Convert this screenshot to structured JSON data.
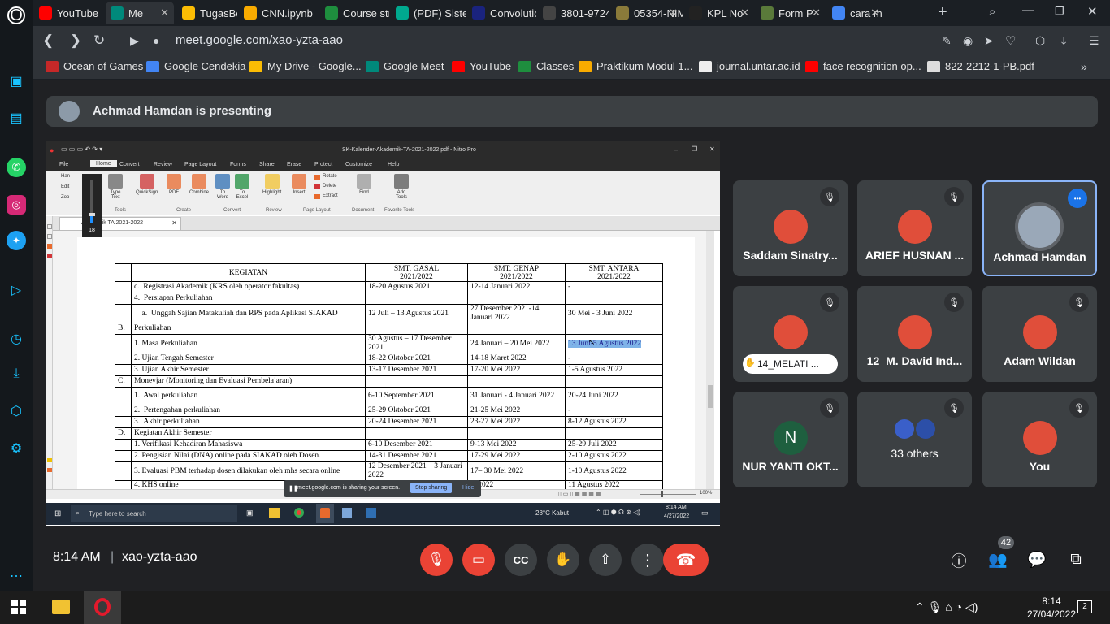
{
  "browser": {
    "tabs": [
      {
        "label": "YouTube",
        "icon": "youtube-icon",
        "color": "#ff0000"
      },
      {
        "label": "Me",
        "icon": "meet-icon",
        "color": "#00897b",
        "active": true
      },
      {
        "label": "TugasBesa",
        "icon": "drive-icon",
        "color": "#fbbc04"
      },
      {
        "label": "CNN.ipynb",
        "icon": "colab-icon",
        "color": "#f9ab00"
      },
      {
        "label": "Course str",
        "icon": "classroom-icon",
        "color": "#1e8e3e"
      },
      {
        "label": "(PDF) Siste",
        "icon": "researchgate-icon",
        "color": "#00a98f"
      },
      {
        "label": "Convolutio",
        "icon": "globe-icon",
        "color": "#1a237e"
      },
      {
        "label": "3801-9724",
        "icon": "globe-icon",
        "color": "#444"
      },
      {
        "label": "05354-NIM",
        "icon": "globe-icon",
        "color": "#8a7a3a"
      },
      {
        "label": "KPL No",
        "icon": "github-icon",
        "color": "#222"
      },
      {
        "label": "Form P",
        "icon": "globe-icon",
        "color": "#5a7a3a"
      },
      {
        "label": "cara m",
        "icon": "google-icon",
        "color": "#4285f4"
      }
    ],
    "url": "meet.google.com/xao-yzta-aao",
    "bookmarks": [
      {
        "label": "Ocean of Games",
        "icon": "gamepad-icon",
        "color": "#c62828"
      },
      {
        "label": "Google Cendekia",
        "icon": "scholar-icon",
        "color": "#4285f4"
      },
      {
        "label": "My Drive - Google...",
        "icon": "drive-icon",
        "color": "#fbbc04"
      },
      {
        "label": "Google Meet",
        "icon": "meet-icon",
        "color": "#00897b"
      },
      {
        "label": "YouTube",
        "icon": "youtube-icon",
        "color": "#ff0000"
      },
      {
        "label": "Classes",
        "icon": "classroom-icon",
        "color": "#1e8e3e"
      },
      {
        "label": "Praktikum Modul 1...",
        "icon": "colab-icon",
        "color": "#f9ab00"
      },
      {
        "label": "journal.untar.ac.id",
        "icon": "pkp-icon",
        "color": "#eeeeee"
      },
      {
        "label": "face recognition op...",
        "icon": "youtube-icon",
        "color": "#ff0000"
      },
      {
        "label": "822-2212-1-PB.pdf",
        "icon": "file-icon",
        "color": "#dddddd"
      }
    ]
  },
  "meet": {
    "presenter_banner": "Achmad Hamdan is presenting",
    "clock": "8:14 AM",
    "divider": "|",
    "meeting_code": "xao-yzta-aao",
    "participant_count": "42",
    "participants": [
      {
        "name": "Saddam Sinatry...",
        "muted": true
      },
      {
        "name": "ARIEF HUSNAN ...",
        "muted": true
      },
      {
        "name": "Achmad Hamdan",
        "muted": false,
        "speaking": true
      },
      {
        "name": "14_MELATI ...",
        "muted": true,
        "hand_raised": true
      },
      {
        "name": "12_M. David Ind...",
        "muted": true
      },
      {
        "name": "Adam Wildan",
        "muted": true
      },
      {
        "name": "NUR YANTI OKT...",
        "muted": true,
        "initial": "N",
        "avatar_color": "#1e5f3f"
      },
      {
        "name": "33 others",
        "muted": true
      },
      {
        "name": "You",
        "muted": true
      }
    ]
  },
  "nitro": {
    "title": "SK-Kalender-Akademik-TA-2021-2022.pdf - Nitro Pro",
    "menu": [
      "File",
      "Home",
      "Convert",
      "Review",
      "Page Layout",
      "Forms",
      "Share",
      "Erase",
      "Protect",
      "Customize",
      "Help"
    ],
    "ribbon": [
      {
        "label": "Type\nText"
      },
      {
        "label": "QuickSign"
      },
      {
        "label": "PDF"
      },
      {
        "label": "Combine"
      },
      {
        "label": "To\nWord"
      },
      {
        "label": "To\nExcel"
      },
      {
        "label": "Highlight"
      },
      {
        "label": "Insert"
      },
      {
        "label": "Rotate"
      },
      {
        "label": "Delete"
      },
      {
        "label": "Extract"
      },
      {
        "label": "Find"
      },
      {
        "label": "Add\nTools"
      }
    ],
    "groups": [
      "Tools",
      "Create",
      "Convert",
      "Review",
      "Page Layout",
      "Document",
      "Favorite Tools"
    ],
    "left_tools": [
      "Han",
      "Edit",
      "Zoo"
    ],
    "doc_tab": "Akademik TA 2021-2022",
    "volume": "18",
    "zoom": "100%",
    "table": {
      "headers": [
        "KEGIATAN",
        "SMT. GASAL\n2021/2022",
        "SMT. GENAP\n2021/2022",
        "SMT. ANTARA\n2021/2022"
      ],
      "rows": [
        {
          "no": "",
          "text": "c.  Registrasi Akademik (KRS oleh operator fakultas)",
          "gasal": "18-20 Agustus 2021",
          "genap": "12-14 Januari 2022",
          "antara": "-"
        },
        {
          "no": "",
          "text": "4.  Persiapan Perkuliahan",
          "gasal": "",
          "genap": "",
          "antara": ""
        },
        {
          "no": "",
          "text": "    a.  Unggah Sajian Matakuliah dan RPS pada Aplikasi SIAKAD",
          "gasal": "12 Juli – 13 Agustus 2021",
          "genap": "27 Desember 2021-14 Januari 2022",
          "antara": "30 Mei - 3 Juni 2022"
        },
        {
          "no": "B.",
          "text": "Perkuliahan",
          "gasal": "",
          "genap": "",
          "antara": ""
        },
        {
          "no": "",
          "text": "1. Masa Perkuliahan",
          "gasal": "30 Agustus – 17 Desember 2021",
          "genap": "24 Januari – 20 Mei 2022",
          "antara": "13 Juni-5 Agustus 2022",
          "highlight": true
        },
        {
          "no": "",
          "text": "2. Ujian Tengah Semester",
          "gasal": "18-22 Oktober 2021",
          "genap": "14-18 Maret 2022",
          "antara": "-"
        },
        {
          "no": "",
          "text": "3. Ujian Akhir Semester",
          "gasal": "13-17 Desember 2021",
          "genap": "17-20 Mei 2022",
          "antara": "1-5 Agustus 2022"
        },
        {
          "no": "C.",
          "text": "Monevjar (Monitoring dan Evaluasi Pembelajaran)",
          "gasal": "",
          "genap": "",
          "antara": ""
        },
        {
          "no": "",
          "text": "1.  Awal perkuliahan",
          "gasal": "6-10 September 2021",
          "genap": "31 Januari - 4 Januari 2022",
          "antara": "20-24 Juni 2022"
        },
        {
          "no": "",
          "text": "2.  Pertengahan perkuliahan",
          "gasal": "25-29 Oktober 2021",
          "genap": "21-25 Mei 2022",
          "antara": "-"
        },
        {
          "no": "",
          "text": "3.  Akhir perkuliahan",
          "gasal": "20-24 Desember 2021",
          "genap": "23-27 Mei 2022",
          "antara": "8-12 Agustus 2022"
        },
        {
          "no": "D.",
          "text": "Kegiatan Akhir Semester",
          "gasal": "",
          "genap": "",
          "antara": ""
        },
        {
          "no": "",
          "text": "1. Verifikasi Kehadiran Mahasiswa",
          "gasal": "6-10 Desember 2021",
          "genap": "9-13 Mei 2022",
          "antara": "25-29 Juli 2022"
        },
        {
          "no": "",
          "text": "2. Pengisian Nilai (DNA) online pada SIAKAD oleh Dosen.",
          "gasal": "14-31 Desember 2021",
          "genap": "17-29 Mei 2022",
          "antara": "2-10 Agustus 2022"
        },
        {
          "no": "",
          "text": "3. Evaluasi PBM terhadap dosen dilakukan oleh mhs secara online",
          "gasal": "12 Desember 2021 – 3 Januari 2022",
          "genap": "17– 30 Mei 2022",
          "antara": "1-10 Agustus 2022"
        },
        {
          "no": "",
          "text": "4. KHS online",
          "gasal": "",
          "genap": "ei 2022",
          "antara": "11 Agustus 2022"
        }
      ]
    },
    "share_popup": {
      "text": "meet.google.com is sharing your screen.",
      "stop": "Stop sharing",
      "hide": "Hide"
    },
    "taskbar": {
      "search": "Type here to search",
      "weather": "28°C  Kabut",
      "time": "8:14 AM",
      "date": "4/27/2022"
    }
  },
  "os_taskbar": {
    "time": "8:14",
    "date": "27/04/2022",
    "notif": "2"
  },
  "colors": {
    "meet_bg": "#202124",
    "tile_bg": "#3c4043",
    "red": "#ea4335",
    "speaking_border": "#8ab4f8"
  }
}
